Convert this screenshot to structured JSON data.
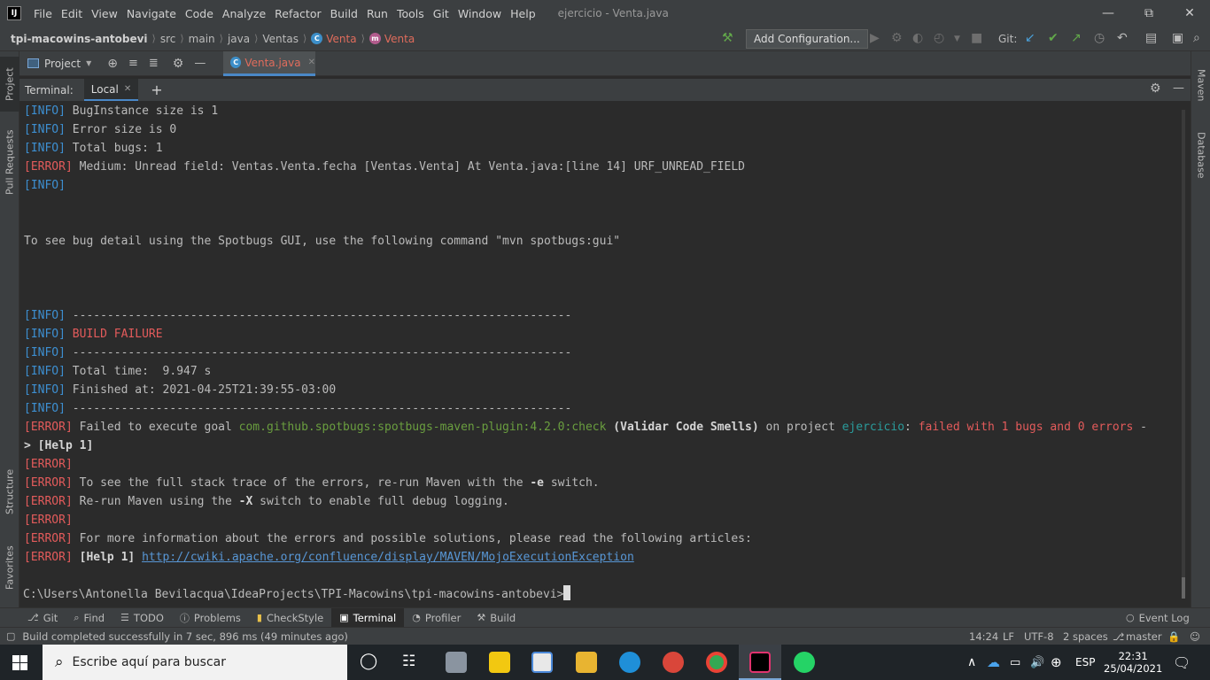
{
  "menubar": {
    "items": [
      "File",
      "Edit",
      "View",
      "Navigate",
      "Code",
      "Analyze",
      "Refactor",
      "Build",
      "Run",
      "Tools",
      "Git",
      "Window",
      "Help"
    ],
    "title": "ejercicio - Venta.java"
  },
  "navbar": {
    "crumbs": [
      "tpi-macowins-antobevi",
      "src",
      "main",
      "java",
      "Ventas",
      "Venta",
      "Venta"
    ],
    "add_config": "Add Configuration...",
    "git_label": "Git:"
  },
  "project_header": {
    "label": "Project"
  },
  "editor": {
    "tab_label": "Venta.java"
  },
  "terminal": {
    "header_label": "Terminal:",
    "tab_label": "Local",
    "prompt": "C:\\Users\\Antonella Bevilacqua\\IdeaProjects\\TPI-Macowins\\tpi-macowins-antobevi>"
  },
  "log": {
    "l1": "BugInstance size is 1",
    "l2": "Error size is 0",
    "l3": "Total bugs: 1",
    "l4": "Medium: Unread field: Ventas.Venta.fecha [Ventas.Venta] At Venta.java:[line 14] URF_UNREAD_FIELD",
    "l5": "To see bug detail using the Spotbugs GUI, use the following command \"mvn spotbugs:gui\"",
    "dashes": "------------------------------------------------------------------------",
    "build_failure": "BUILD FAILURE",
    "total_time": "Total time:  9.947 s",
    "finished": "Finished at: 2021-04-25T21:39:55-03:00",
    "fail_a": "Failed to execute goal ",
    "fail_goal": "com.github.spotbugs:spotbugs-maven-plugin:4.2.0:check",
    "fail_b": "(Validar Code Smells)",
    "fail_c": " on project ",
    "fail_project": "ejercicio",
    "fail_d": ": ",
    "fail_e": "failed with 1 bugs and 0 errors",
    "fail_f": " -",
    "help_cont": "> [Help 1]",
    "trace_a": "To see the full stack trace of the errors, re-run Maven with the ",
    "trace_b": "-e",
    "trace_c": " switch.",
    "rerun_a": "Re-run Maven using the ",
    "rerun_b": "-X",
    "rerun_c": " switch to enable full debug logging.",
    "more_info": "For more information about the errors and possible solutions, please read the following articles:",
    "help1": "[Help 1]",
    "help_link": "http://cwiki.apache.org/confluence/display/MAVEN/MojoExecutionException",
    "tag_info": "[INFO]",
    "tag_error": "[ERROR]"
  },
  "side": {
    "left": [
      "Project",
      "Pull Requests",
      "Structure",
      "Favorites"
    ],
    "right": [
      "Maven",
      "Database"
    ]
  },
  "bottom_tabs": [
    "Git",
    "Find",
    "TODO",
    "Problems",
    "CheckStyle",
    "Terminal",
    "Profiler",
    "Build"
  ],
  "event_log": "Event Log",
  "status": {
    "message": "Build completed successfully in 7 sec, 896 ms (49 minutes ago)",
    "position": "14:24",
    "line_sep": "LF",
    "encoding": "UTF-8",
    "indent": "2 spaces",
    "branch": "master"
  },
  "taskbar": {
    "search_placeholder": "Escribe aquí para buscar",
    "lang": "ESP",
    "time": "22:31",
    "date": "25/04/2021"
  },
  "colors": {
    "info": "#3d8fd1",
    "error": "#e35b5b",
    "goal": "#6a9e3f",
    "project": "#2a9c9c",
    "link": "#5897d6"
  }
}
